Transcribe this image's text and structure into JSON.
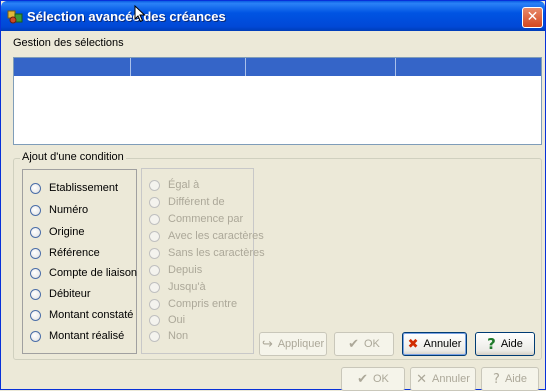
{
  "window": {
    "title": "Sélection avancée des créances",
    "close_glyph": "✕"
  },
  "selections": {
    "label": "Gestion des sélections"
  },
  "condition": {
    "legend": "Ajout d'une condition",
    "fields": [
      "Etablissement",
      "Numéro",
      "Origine",
      "Référence",
      "Compte de liaison",
      "Débiteur",
      "Montant constaté",
      "Montant réalisé"
    ],
    "operators": [
      "Égal à",
      "Différent de",
      "Commence par",
      "Avec les caractères",
      "Sans les caractères",
      "Depuis",
      "Jusqu'à",
      "Compris entre",
      "Oui",
      "Non"
    ]
  },
  "condition_buttons": {
    "apply": "Appliquer",
    "ok": "OK",
    "cancel": "Annuler",
    "help": "Aide"
  },
  "footer_buttons": {
    "ok": "OK",
    "cancel": "Annuler",
    "help": "Aide"
  },
  "icons": {
    "apply": "apply-arrow-icon",
    "ok": "checkmark-icon",
    "cancel": "red-x-icon",
    "help": "question-mark-icon"
  },
  "colors": {
    "titlebar": "#0054e3",
    "list_header": "#3565c8",
    "dialog_bg": "#ece9d8"
  }
}
